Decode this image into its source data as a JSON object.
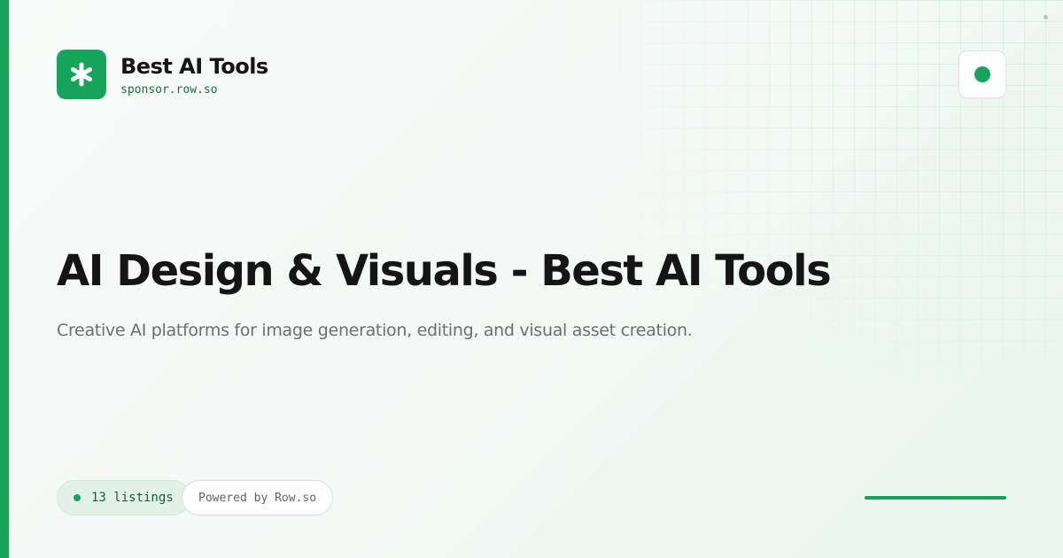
{
  "brand": {
    "name": "Best AI Tools",
    "domain": "sponsor.row.so",
    "logo_icon": "asterisk-icon"
  },
  "heading": {
    "title": "AI Design & Visuals - Best AI Tools",
    "subtitle": "Creative AI platforms for image generation, editing, and visual asset creation."
  },
  "footer": {
    "listings_label": "13 listings",
    "powered_label": "Powered by Row.so"
  },
  "indicators": {
    "status_icon": "status-dot-icon"
  },
  "colors": {
    "accent": "#16a35a",
    "text": "#151515",
    "muted": "#6b6f73",
    "brand_domain": "#17703f"
  }
}
